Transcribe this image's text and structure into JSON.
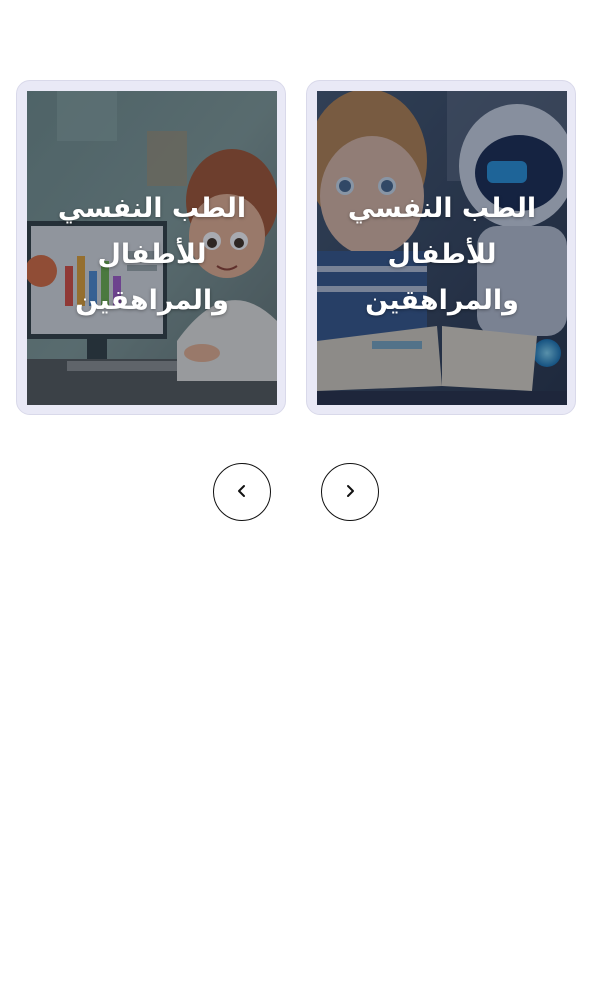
{
  "carousel": {
    "cards": [
      {
        "title": "الطب النفسي للأطفال والمراهقين",
        "image": "child-at-computer-illustration"
      },
      {
        "title": "الطب النفسي للأطفال والمراهقين",
        "image": "child-with-robot-reading-illustration"
      }
    ]
  },
  "controls": {
    "prev_icon": "chevron-left-icon",
    "next_icon": "chevron-right-icon"
  }
}
